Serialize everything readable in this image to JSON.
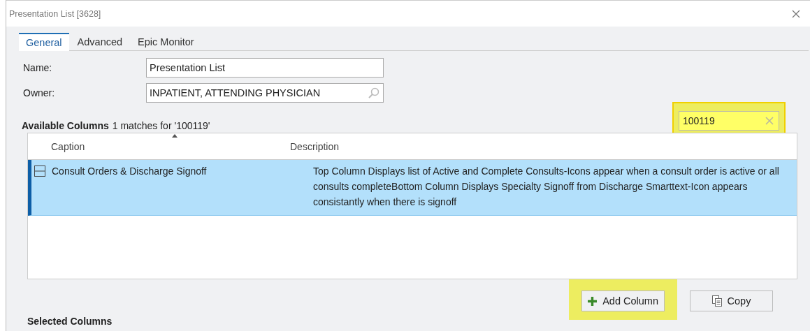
{
  "window": {
    "title": "Presentation List [3628]"
  },
  "tabs": [
    {
      "label": "General",
      "selected": true
    },
    {
      "label": "Advanced",
      "selected": false
    },
    {
      "label": "Epic Monitor",
      "selected": false
    }
  ],
  "fields": [
    {
      "label": "Name:",
      "value": "Presentation List",
      "kind": "text"
    },
    {
      "label": "Owner:",
      "value": "INPATIENT, ATTENDING PHYSICIAN",
      "kind": "lookup"
    }
  ],
  "available_columns": {
    "heading": "Available Columns",
    "match_text": "1 matches for '100119'",
    "search": {
      "value": "100119",
      "highlighted": true
    },
    "table": {
      "columns": [
        {
          "label": "Caption",
          "sorted": true
        },
        {
          "label": "Description",
          "sorted": false
        }
      ],
      "rows": [
        {
          "caption": "Consult Orders & Discharge Signoff",
          "description": "Top Column Displays list of Active and Complete Consults-Icons appear when a consult order is active or all consults completeBottom Column Displays Specialty Signoff from Discharge Smarttext-Icon appears consistantly when there is signoff",
          "selected": true
        }
      ]
    }
  },
  "buttons": [
    {
      "label": "Add Column",
      "kind": "add",
      "highlighted": true
    },
    {
      "label": "Copy",
      "kind": "copy",
      "highlighted": false
    }
  ],
  "selected_columns": {
    "heading": "Selected Columns"
  }
}
